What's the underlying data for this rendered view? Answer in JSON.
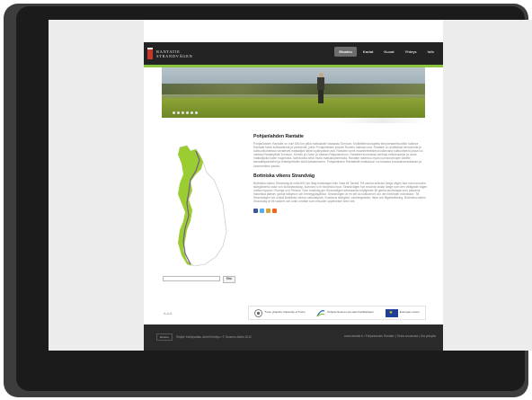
{
  "site": {
    "logo_line1": "RANTATIE",
    "logo_line2": "STRANDVÄGEN"
  },
  "nav": {
    "items": [
      {
        "label": "Etusivu"
      },
      {
        "label": "Kartat"
      },
      {
        "label": "Kuvat"
      },
      {
        "label": "Yhteys"
      },
      {
        "label": "Info"
      }
    ]
  },
  "content": {
    "section1_title": "Pohjanlahden Rantatie",
    "section1_body": "Pohjanlahden Rantatie on noin 600 km pitkä matkailutie Vaasasta Tornioon. Mutkittelevia kapeita tienpientareita pitkin kulkeva Rantatie toimii kulttuuriteinä ja perinteinä, joihin Pohjanlahden ympäri Ruotsin rakkaat ovat. Rantatie on yhdistänyt tienvarrella ja kulttuurikohteissa vierailevat matkailijat näihin kylänpäisiin asti. Rantatie toimii maantieteellisesti kulkevana kulttuuritienä jossa voi vaeltaa Rantakylistä Tornioon, Kemiin ja Oulun ja Vaasan Raippaluotoon. Rantatiet kunnostaa vanhoja erikoisuuksia ja uusia matkailijoita kuten majoitusta, ravintoloita sekä muita matkailupalveluita. Rantatie rakentuu myös luonnonarvojen äärelle kansallispuistoihin ja retkeilyreiteille sekä kalastukseen. Pohjanlahden Rantatiellä matkailuun voi tutustua kuvausharrastuksen ja luontoretkien kautta.",
    "section2_title": "Bottniska vikens Strandväg",
    "section2_body": "Bottniska vikens Strandväg är cirka 600 km lång turistvägen från Vasa till Torneå. På vackra sträckor längs vägen kan man beundra skärgårdens natur och kulturlandskap, kulturarv och historiska byar. Strandvägen har använts sedan länge som den viktigaste vägen mellan byarna i Sverige och Finland. Som turistväg ger Strandvägen intressanta möjligheter till gamla landsvägar som passerar historiska platser, gamla träkyrkor och hembygdsgårdar. Strandvägen är en del av kulturarvet och den förbinder människor. Till Strandvägen hör också Bottniska vikens nationalpark, Kvarkens skärgård, vandringsleder, fiske och fågelskådning. Bottniska vikens Strandväg är ett vackert och unikt område som erbjuder upplevelser året runt."
  },
  "search": {
    "placeholder": "",
    "button_label": "Etsi"
  },
  "footer": {
    "font_size_label": "A A A",
    "partner1": "Turun yliopisto University of Turku",
    "partner2": "Pohjois-Suomen ja Lapin Kehittämisen",
    "partner3": "Euroopan unioni",
    "left_button": "Etusivu",
    "left_text": "Tekijät: Kehitysatlas, Antell Kehitys • © Suomen Aktiivi 2012",
    "right_text": "www.rantatie.fi • Pohjanlahden Rantatie | Tietoa sivustosta | Ota yhteyttä"
  },
  "colors": {
    "accent": "#8cc63e",
    "header": "#232323",
    "map_green": "#9acd32",
    "share_fb": "#3b5998",
    "share_tw": "#55acee",
    "share_mail": "#d9a33b",
    "share_rss": "#f26522"
  }
}
